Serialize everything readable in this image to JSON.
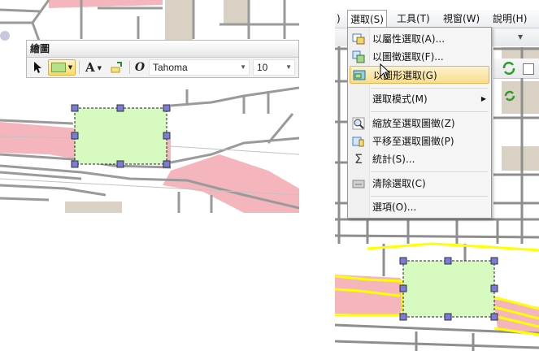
{
  "left": {
    "toolbar": {
      "title": "繪圖",
      "font_name": "Tahoma",
      "font_size": "10",
      "text_tool_glyph": "A",
      "font_style_glyph": "O"
    },
    "icons": [
      "pointer-icon",
      "fill-color-icon",
      "text-icon",
      "marker-icon",
      "font-italic-icon"
    ]
  },
  "right": {
    "menubar": {
      "items": [
        ")",
        "選取(S)",
        "工具(T)",
        "視窗(W)",
        "說明(H)"
      ]
    },
    "menu": {
      "items": [
        {
          "label": "以屬性選取(A)...",
          "icon": "attribute-select-icon"
        },
        {
          "label": "以圖徵選取(F)...",
          "icon": "feature-select-icon"
        },
        {
          "label": "以圖形選取(G)",
          "icon": "graphic-select-icon",
          "highlighted": true
        },
        {
          "label": "選取模式(M)",
          "icon": "",
          "submenu": true
        },
        {
          "label": "縮放至選取圖徵(Z)",
          "icon": "zoom-to-selected-icon"
        },
        {
          "label": "平移至選取圖徵(P)",
          "icon": "pan-to-selected-icon"
        },
        {
          "label": "統計(S)...",
          "icon": "sigma-icon"
        },
        {
          "label": "清除選取(C)",
          "icon": "clear-selection-icon"
        },
        {
          "label": "選項(O)...",
          "icon": ""
        }
      ]
    },
    "glyphs": {
      "sigma": "Σ",
      "submenu_arrow": "▶",
      "combo_arrow": "▼"
    }
  },
  "colors": {
    "road": "#999999",
    "pink_area": "#f4b6bc",
    "tan_area": "#d9d2c4",
    "rect_fill": "#d7fac0",
    "handle": "#7b7bdb",
    "highlight": "#ffff00",
    "menu_highlight": "#f8dd8c"
  }
}
